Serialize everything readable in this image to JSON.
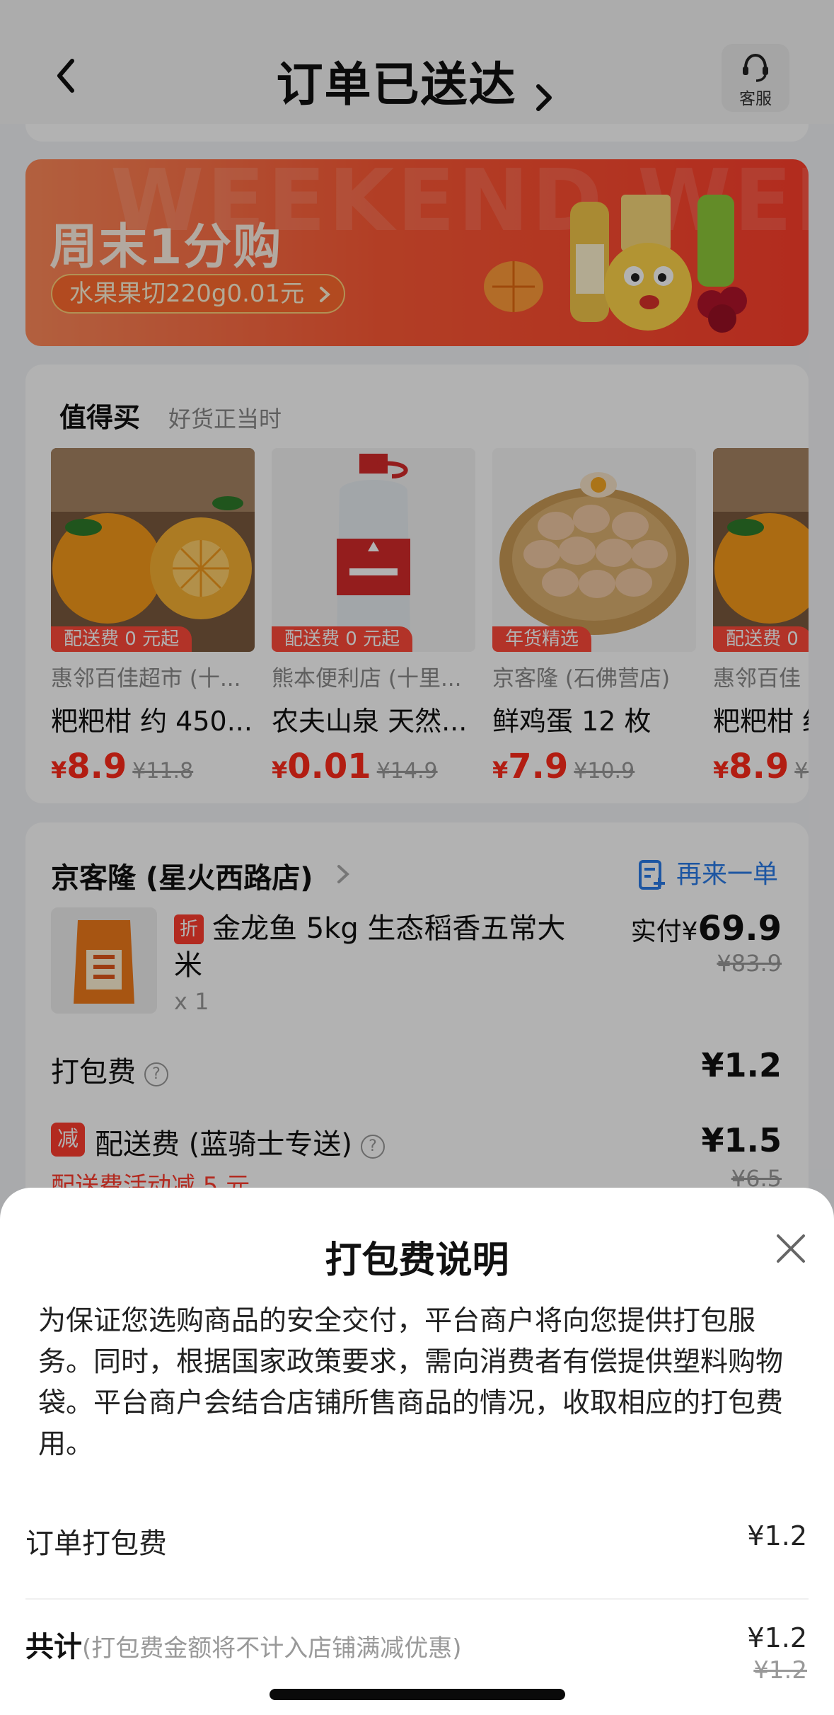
{
  "header": {
    "title": "订单已送达",
    "service_label": "客服"
  },
  "banner": {
    "bg_text": "WEEKEND WEEKEND",
    "title": "周末1分购",
    "pill": "水果果切220g0.01元"
  },
  "worth_buy": {
    "title": "值得买",
    "subtitle": "好货正当时",
    "products": [
      {
        "tag": "配送费 0 元起",
        "shop": "惠邻百佳超市 (十...",
        "name": "粑粑柑 约 450...",
        "symbol": "¥",
        "price": "8.9",
        "old_price": "¥11.8"
      },
      {
        "tag": "配送费 0 元起",
        "shop": "熊本便利店 (十里...",
        "name": "农夫山泉 天然...",
        "symbol": "¥",
        "price": "0.01",
        "old_price": "¥14.9"
      },
      {
        "tag": "年货精选",
        "shop": "京客隆 (石佛营店)",
        "name": "鲜鸡蛋 12 枚",
        "symbol": "¥",
        "price": "7.9",
        "old_price": "¥10.9"
      },
      {
        "tag": "配送费 0",
        "shop": "惠邻百佳",
        "name": "粑粑柑 约",
        "symbol": "¥",
        "price": "8.9",
        "old_price": "¥1"
      }
    ]
  },
  "order": {
    "shop_name": "京客隆 (星火西路店)",
    "reorder_label": "再来一单",
    "item": {
      "badge": "折",
      "name": "金龙鱼 5kg 生态稻香五常大米",
      "qty": "x 1",
      "paid_prefix": "实付¥",
      "paid_amount": "69.9",
      "old_price": "¥83.9"
    },
    "packing_label": "打包费",
    "packing_value": "¥1.2",
    "delivery_badge": "减",
    "delivery_label": "配送费 (蓝骑士专送)",
    "delivery_value": "¥1.5",
    "delivery_promo": "配送费活动减 5 元",
    "delivery_old": "¥6.5"
  },
  "sheet": {
    "title": "打包费说明",
    "description": "为保证您选购商品的安全交付，平台商户将向您提供打包服务。同时，根据国家政策要求，需向消费者有偿提供塑料购物袋。平台商户会结合店铺所售商品的情况，收取相应的打包费用。",
    "order_packing_label": "订单打包费",
    "order_packing_value": "¥1.2",
    "total_label": "共计",
    "total_note": "(打包费金额将不计入店铺满减优惠)",
    "total_value": "¥1.2",
    "total_old": "¥1.2"
  }
}
